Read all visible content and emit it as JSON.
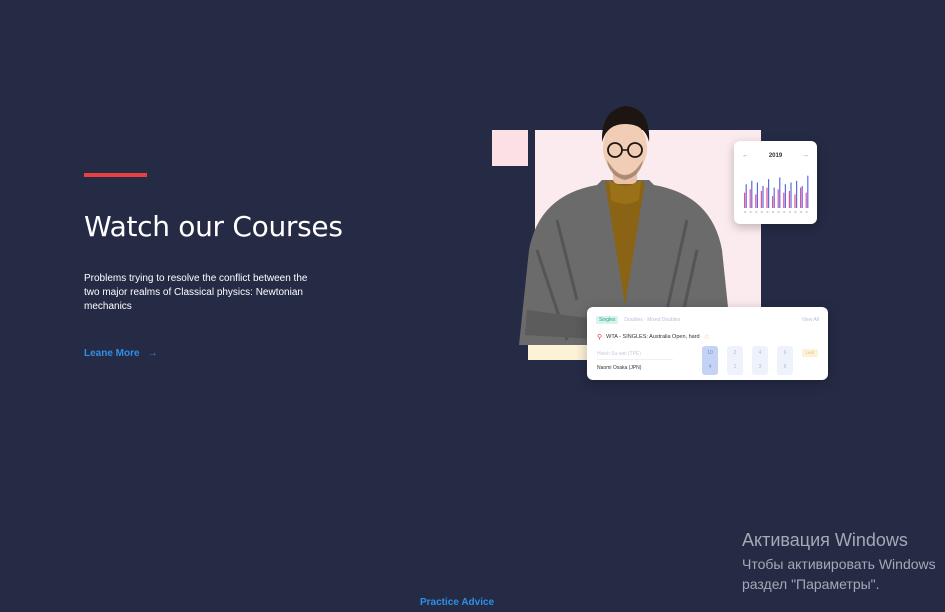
{
  "hero": {
    "title": "Watch our Courses",
    "description": "Problems trying to resolve the conflict between the two major realms of Classical physics: Newtonian mechanics",
    "link_label": "Leane More",
    "link_arrow": "→"
  },
  "calendar_card": {
    "prev_arrow": "←",
    "year": "2019",
    "next_arrow": "→",
    "bar_colors": [
      "#e74e9a",
      "#5b6be0"
    ],
    "levels": [
      [
        0.45,
        0.7
      ],
      [
        0.55,
        0.8
      ],
      [
        0.4,
        0.75
      ],
      [
        0.5,
        0.65
      ],
      [
        0.6,
        0.85
      ],
      [
        0.35,
        0.6
      ],
      [
        0.55,
        0.9
      ],
      [
        0.45,
        0.7
      ],
      [
        0.5,
        0.75
      ],
      [
        0.4,
        0.8
      ],
      [
        0.6,
        0.65
      ],
      [
        0.45,
        0.95
      ]
    ]
  },
  "match_card": {
    "tab_active": "Singles",
    "tab_other": "Doubles · Mixed Doubles",
    "view_all": "View All",
    "event": "WTA - SINGLES: Australia Open, hard",
    "player1": "Hsieh Su-wei (TPE)",
    "player2": "Naomi Osaka (JPN)",
    "scores": [
      [
        "10",
        "4"
      ],
      [
        "2",
        "1"
      ],
      [
        "4",
        "3"
      ],
      [
        "6",
        "6"
      ]
    ],
    "badge": "LIVE",
    "colors": {
      "active_tab_bg": "#d8f3ee",
      "active_score_bg": "#c4d2f5"
    },
    "icons": {
      "event": "pin-icon",
      "favorite": "star-icon"
    }
  },
  "footer": {
    "link": "Practice Advice"
  },
  "windows_watermark": {
    "title": "Активация Windows",
    "line1": "Чтобы активировать Windows",
    "line2": "раздел \"Параметры\"."
  },
  "colors": {
    "background": "#252b45",
    "accent": "#e74040",
    "link": "#2f8fe6",
    "title": "#ffffff"
  }
}
